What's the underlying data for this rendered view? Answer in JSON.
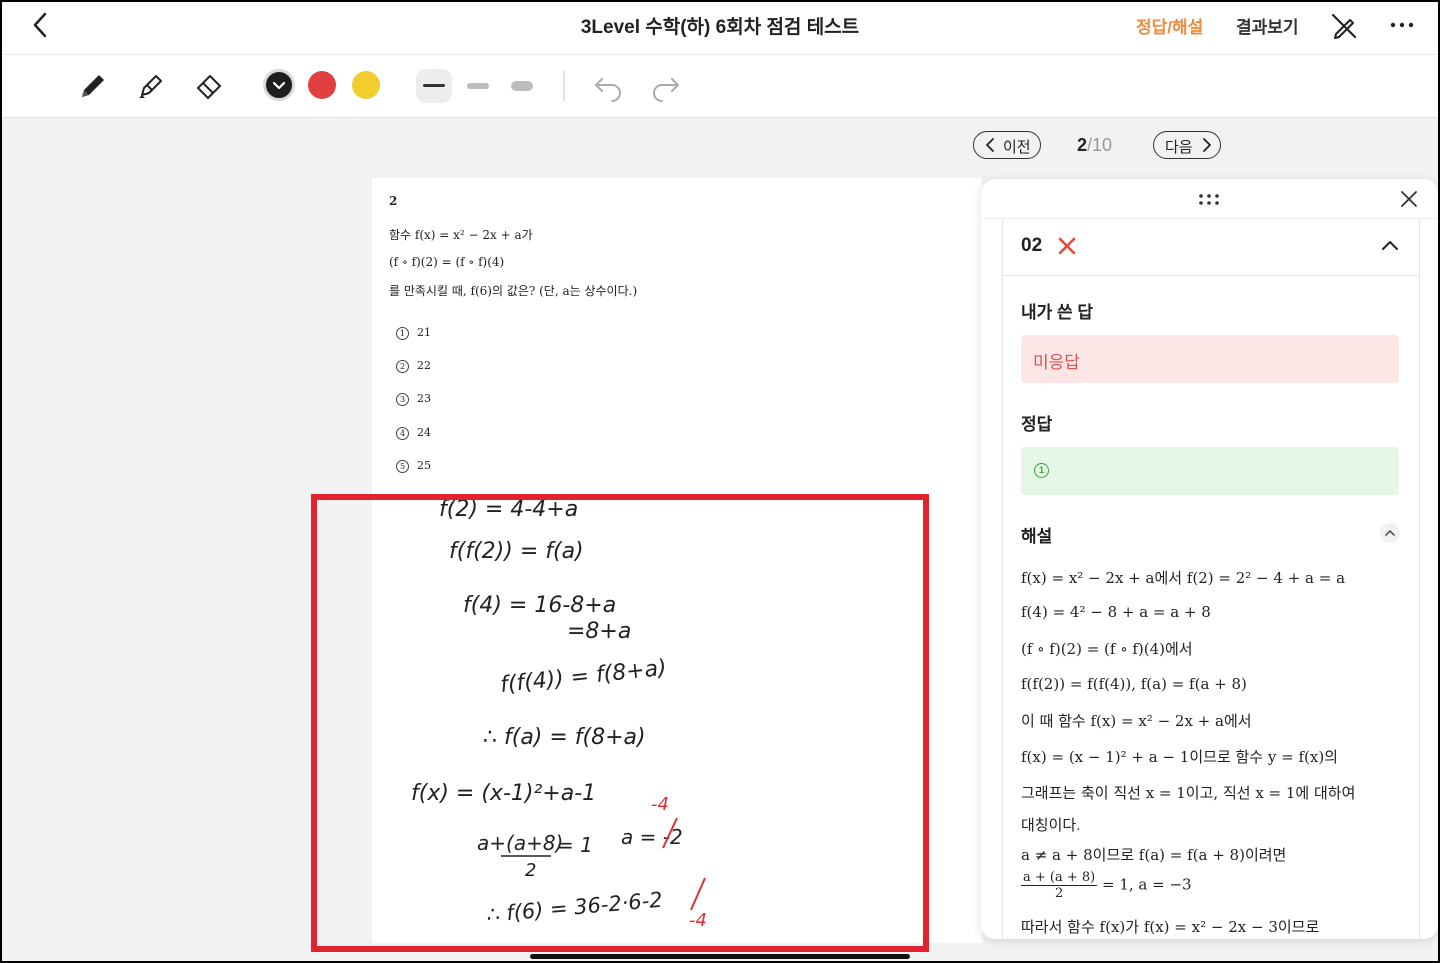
{
  "header": {
    "title": "3Level 수학(하) 6회차 점검 테스트",
    "answers_label": "정답/해설",
    "results_label": "결과보기"
  },
  "toolbar": {
    "tools": [
      "pen-icon",
      "highlighter-icon",
      "eraser-icon"
    ],
    "colors": [
      "#1f1f1f",
      "#e04040",
      "#f2cd2e"
    ],
    "stroke_widths": [
      "thin",
      "medium",
      "thick"
    ],
    "selected_stroke": "thin"
  },
  "pager": {
    "prev_label": "이전",
    "next_label": "다음",
    "current": "2",
    "total": "/10"
  },
  "question": {
    "number": "2",
    "line1": "함수 f(x) = x² − 2x + a가",
    "line2": "(f ∘ f)(2) = (f ∘ f)(4)",
    "line3": "를 만족시킬 때, f(6)의 값은? (단, a는 상수이다.)",
    "options": [
      {
        "num": "1",
        "mark": "①",
        "value": "21"
      },
      {
        "num": "2",
        "mark": "②",
        "value": "22"
      },
      {
        "num": "3",
        "mark": "③",
        "value": "23"
      },
      {
        "num": "4",
        "mark": "④",
        "value": "24"
      },
      {
        "num": "5",
        "mark": "⑤",
        "value": "25"
      }
    ]
  },
  "handwriting": {
    "lines": [
      "f(2) = 4-4+a",
      "f(f(2)) = f(a)",
      "f(4) = 16-8+a",
      "=8+a",
      "f(f(4)) = f(8+a)",
      "∴ f(a) = f(8+a)",
      "f(x) = (x-1)²+a-1",
      "a+(a+8)",
      "2",
      "= 1",
      "a = -2",
      "-4",
      "∴ f(6) = 36-2·6-2",
      "-4"
    ]
  },
  "panel": {
    "question_badge": "02",
    "my_answer_label": "내가 쓴 답",
    "my_answer_value": "미응답",
    "correct_label": "정답",
    "correct_value": "1",
    "correct_mark": "①",
    "solution_label": "해설",
    "solution": {
      "l1": "f(x) = x² − 2x + a에서 f(2) = 2² − 4 + a = a",
      "l2": "f(4) = 4² − 8 + a = a + 8",
      "l3": "(f ∘ f)(2) = (f ∘ f)(4)에서",
      "l4": "f(f(2)) = f(f(4)), f(a) = f(a + 8)",
      "l5": "이 때 함수 f(x) = x² − 2x + a에서",
      "l6": "f(x) = (x − 1)² + a − 1이므로 함수 y = f(x)의",
      "l7": "그래프는 축이 직선 x = 1이고, 직선 x = 1에 대하여",
      "l8": "대칭이다.",
      "l9": "a ≠ a + 8이므로 f(a) = f(a + 8)이려면",
      "l10_num": "a + (a + 8)",
      "l10_den": "2",
      "l10_rest": "= 1, a = −3",
      "l11": "따라서 함수 f(x)가 f(x) = x² − 2x − 3이므로"
    }
  }
}
